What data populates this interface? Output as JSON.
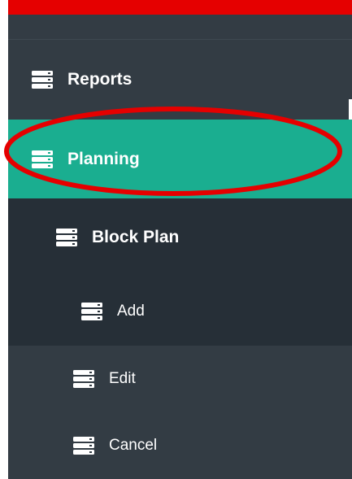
{
  "sidebar": {
    "items": [
      {
        "label": "Reports",
        "icon": "server-icon",
        "expand_icon": "plus-square-icon"
      },
      {
        "label": "Planning",
        "icon": "server-icon"
      },
      {
        "label": "Block Plan",
        "icon": "server-icon"
      },
      {
        "label": "Add",
        "icon": "server-icon"
      },
      {
        "label": "Edit",
        "icon": "server-icon"
      },
      {
        "label": "Cancel",
        "icon": "server-icon"
      }
    ]
  },
  "colors": {
    "sidebar_bg": "#333c44",
    "submenu_bg": "#262f37",
    "active_bg": "#1aae90",
    "annotation": "#e50000",
    "text": "#ffffff"
  }
}
